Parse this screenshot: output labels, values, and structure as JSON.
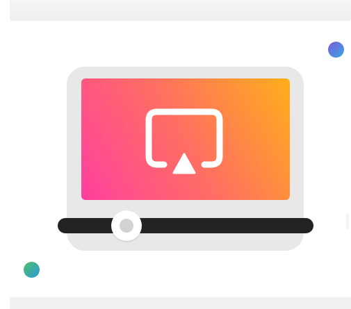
{
  "colors": {
    "screen_gradient_start": "#ff3f9f",
    "screen_gradient_end": "#ffae1b",
    "laptop_frame": "#e8e8e8",
    "progress_track": "#222222",
    "dot_top_start": "#7b5bd6",
    "dot_top_end": "#3aa6e8",
    "dot_bottom_start": "#4fbf6a",
    "dot_bottom_end": "#2b9ad9"
  },
  "icons": {
    "main": "airplay-icon",
    "device": "laptop-icon"
  },
  "playback": {
    "progress_fraction": 0.27
  }
}
